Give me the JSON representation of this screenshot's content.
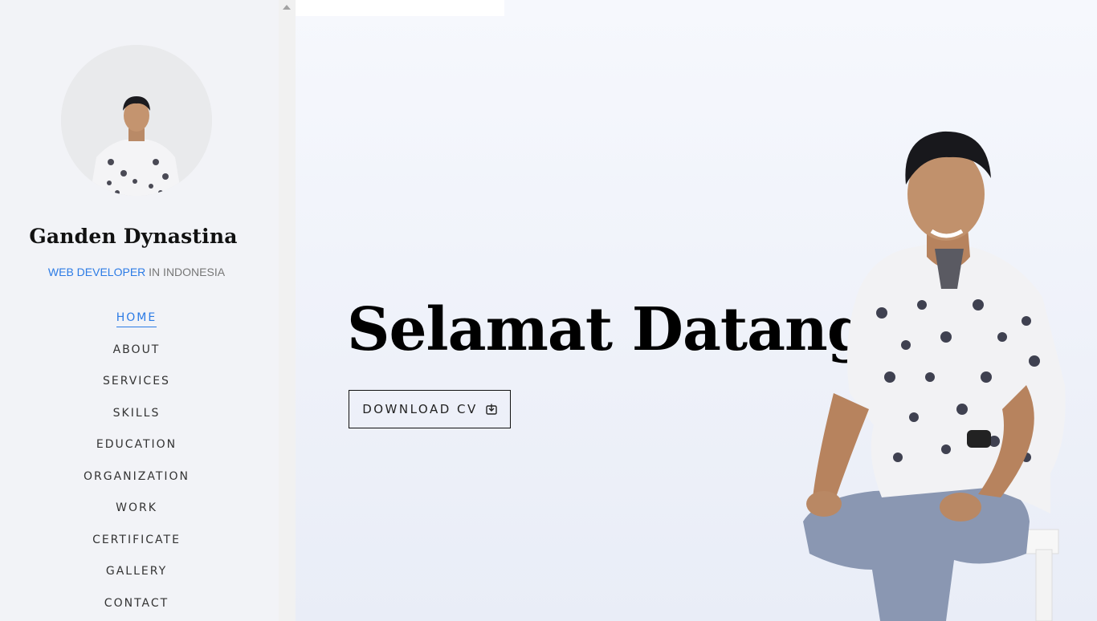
{
  "sidebar": {
    "name": "Ganden Dynastina",
    "tagline_accent": "WEB DEVELOPER",
    "tagline_rest": " IN INDONESIA",
    "nav": [
      {
        "label": "HOME",
        "active": true
      },
      {
        "label": "ABOUT"
      },
      {
        "label": "SERVICES"
      },
      {
        "label": "SKILLS"
      },
      {
        "label": "EDUCATION"
      },
      {
        "label": "ORGANIZATION"
      },
      {
        "label": "WORK"
      },
      {
        "label": "CERTIFICATE"
      },
      {
        "label": "GALLERY"
      },
      {
        "label": "CONTACT"
      }
    ]
  },
  "hero": {
    "title": "Selamat Datang!",
    "button_label": "DOWNLOAD CV",
    "button_icon": "download-icon"
  },
  "colors": {
    "accent": "#2c7be5",
    "sidebar_bg": "#f2f3f7",
    "hero_bg": "#eef1f9"
  }
}
